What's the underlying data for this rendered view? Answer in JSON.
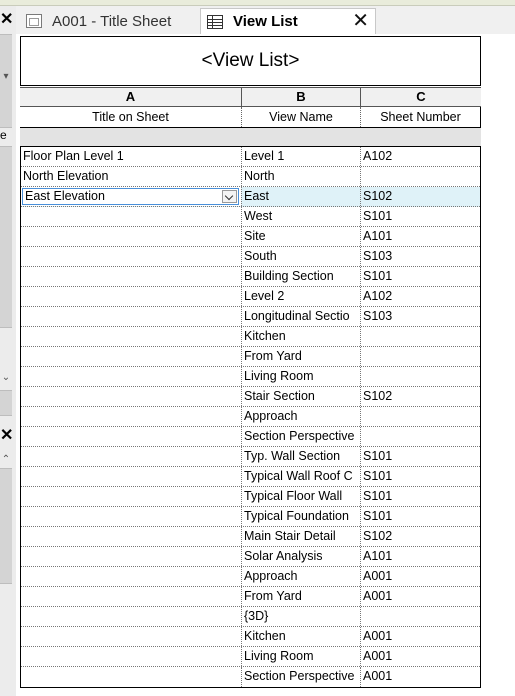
{
  "left_rail": {
    "close_glyph": "✕",
    "chevron_glyph": "⌄",
    "up_glyph": "⌃",
    "letter": "e"
  },
  "tabs": [
    {
      "label": "A001 - Title Sheet",
      "close": "✕",
      "active": false
    },
    {
      "label": "View List",
      "close": "✕",
      "active": true
    }
  ],
  "schedule": {
    "title": "<View List>",
    "column_letters": [
      "A",
      "B",
      "C"
    ],
    "column_headers": [
      "Title on Sheet",
      "View Name",
      "Sheet Number"
    ],
    "rows": [
      {
        "title": "Floor Plan Level 1",
        "view": "Level 1",
        "sheet": "A102"
      },
      {
        "title": "North Elevation",
        "view": "North",
        "sheet": ""
      },
      {
        "title": "East Elevation",
        "view": "East",
        "sheet": "S102"
      },
      {
        "title": "",
        "view": "West",
        "sheet": "S101"
      },
      {
        "title": "",
        "view": "Site",
        "sheet": "A101"
      },
      {
        "title": "",
        "view": "South",
        "sheet": "S103"
      },
      {
        "title": "",
        "view": "Building Section",
        "sheet": "S101"
      },
      {
        "title": "",
        "view": "Level 2",
        "sheet": "A102"
      },
      {
        "title": "",
        "view": "Longitudinal Sectio",
        "sheet": "S103"
      },
      {
        "title": "",
        "view": "Kitchen",
        "sheet": ""
      },
      {
        "title": "",
        "view": "From Yard",
        "sheet": ""
      },
      {
        "title": "",
        "view": "Living Room",
        "sheet": ""
      },
      {
        "title": "",
        "view": "Stair Section",
        "sheet": "S102"
      },
      {
        "title": "",
        "view": "Approach",
        "sheet": ""
      },
      {
        "title": "",
        "view": "Section Perspective",
        "sheet": ""
      },
      {
        "title": "",
        "view": "Typ. Wall Section",
        "sheet": "S101"
      },
      {
        "title": "",
        "view": "Typical Wall Roof C",
        "sheet": "S101"
      },
      {
        "title": "",
        "view": "Typical Floor Wall",
        "sheet": "S101"
      },
      {
        "title": "",
        "view": "Typical Foundation",
        "sheet": "S101"
      },
      {
        "title": "",
        "view": "Main Stair Detail",
        "sheet": "S102"
      },
      {
        "title": "",
        "view": "Solar Analysis",
        "sheet": "A101"
      },
      {
        "title": "",
        "view": "Approach",
        "sheet": "A001"
      },
      {
        "title": "",
        "view": "From Yard",
        "sheet": "A001"
      },
      {
        "title": "",
        "view": "{3D}",
        "sheet": ""
      },
      {
        "title": "",
        "view": "Kitchen",
        "sheet": "A001"
      },
      {
        "title": "",
        "view": "Living Room",
        "sheet": "A001"
      },
      {
        "title": "",
        "view": "Section Perspective",
        "sheet": "A001"
      }
    ],
    "selected_row_index": 2
  }
}
